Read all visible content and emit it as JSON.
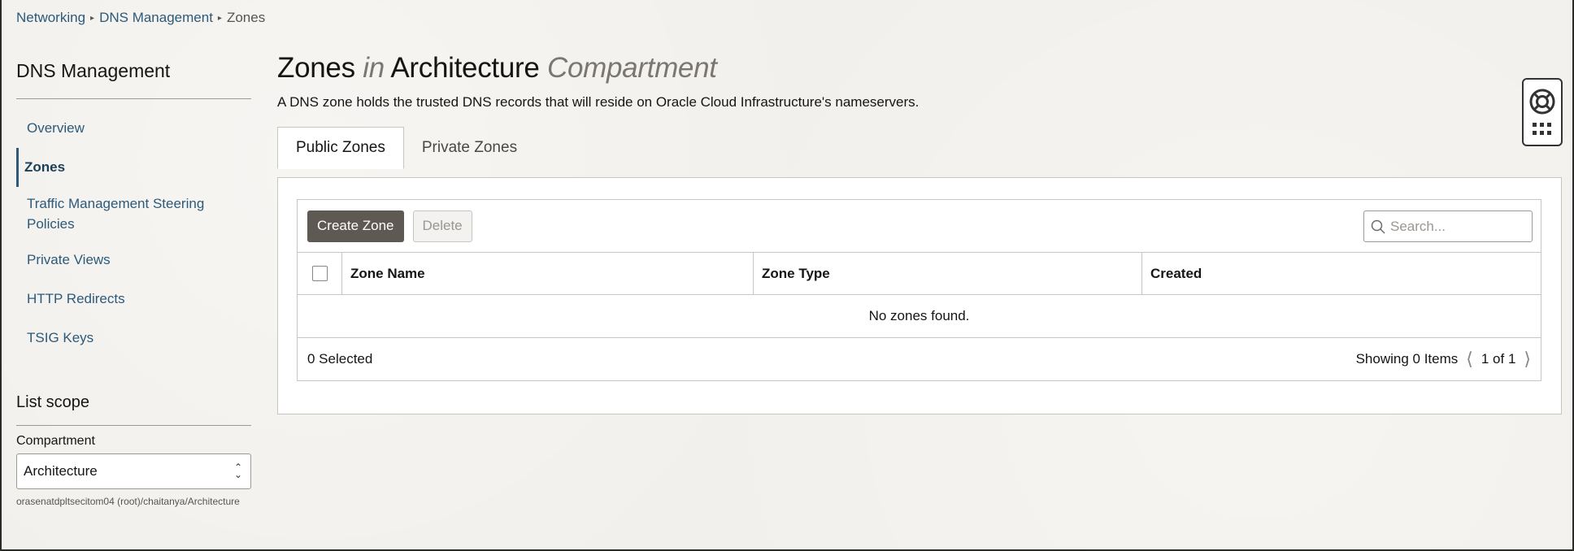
{
  "breadcrumb": {
    "items": [
      "Networking",
      "DNS Management"
    ],
    "current": "Zones"
  },
  "sidebar": {
    "title": "DNS Management",
    "items": [
      {
        "label": "Overview"
      },
      {
        "label": "Zones",
        "active": true
      },
      {
        "label": "Traffic Management Steering Policies"
      },
      {
        "label": "Private Views"
      },
      {
        "label": "HTTP Redirects"
      },
      {
        "label": "TSIG Keys"
      }
    ]
  },
  "scope": {
    "title": "List scope",
    "compartment_label": "Compartment",
    "compartment_value": "Architecture",
    "compartment_path": "orasenatdpltsecitom04 (root)/chaitanya/Architecture"
  },
  "main": {
    "title_part1": "Zones",
    "title_in": "in",
    "title_part2": "Architecture",
    "title_part3": "Compartment",
    "description": "A DNS zone holds the trusted DNS records that will reside on Oracle Cloud Infrastructure's nameservers.",
    "tabs": [
      {
        "label": "Public Zones",
        "active": true
      },
      {
        "label": "Private Zones"
      }
    ]
  },
  "toolbar": {
    "create_label": "Create Zone",
    "delete_label": "Delete",
    "search_placeholder": "Search..."
  },
  "table": {
    "columns": [
      "Zone Name",
      "Zone Type",
      "Created"
    ],
    "empty_message": "No zones found.",
    "selected_text": "0 Selected",
    "showing_text": "Showing 0 Items",
    "page_text": "1 of 1"
  },
  "colors": {
    "link": "#2c5a7a",
    "primary_button": "#5f5954",
    "background": "#f2f0ec"
  }
}
